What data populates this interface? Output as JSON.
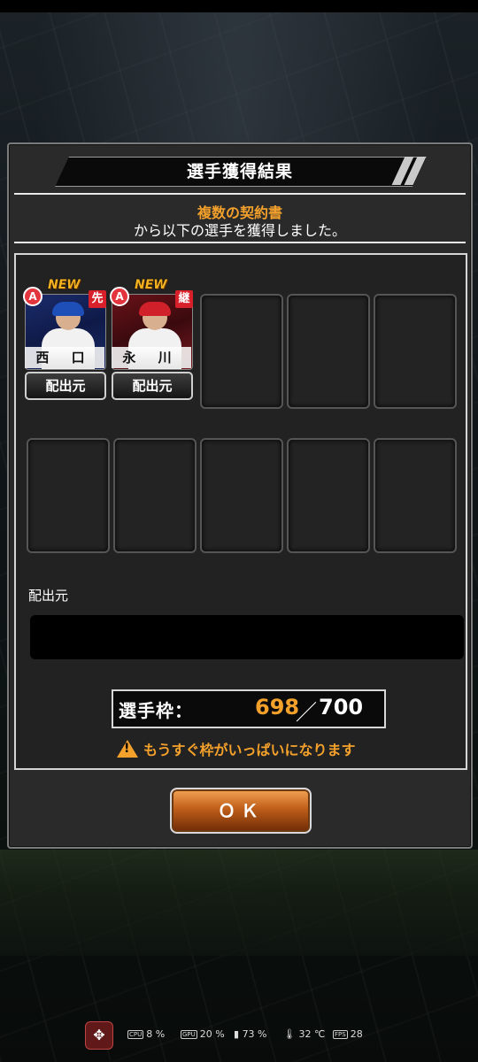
{
  "dialog": {
    "title": "選手獲得結果",
    "message_highlight": "複数の契約書",
    "message_body": "から以下の選手を獲得しました。"
  },
  "players": [
    {
      "name": "西 口",
      "new_label": "NEW",
      "rank_badge": "A",
      "position_badge": "先",
      "source_button": "配出元"
    },
    {
      "name": "永 川",
      "new_label": "NEW",
      "rank_badge": "A",
      "position_badge": "継",
      "source_button": "配出元"
    }
  ],
  "source_section": {
    "label": "配出元"
  },
  "capacity": {
    "label": "選手枠：",
    "current": "698",
    "separator": "／",
    "max": "700"
  },
  "warning": {
    "text": "もうすぐ枠がいっぱいになります"
  },
  "ok_button": {
    "label": "ＯＫ"
  },
  "hud": {
    "cpu": "8 %",
    "gpu": "20 %",
    "battery": "73 %",
    "temperature": "32 ℃",
    "fps": "28"
  }
}
